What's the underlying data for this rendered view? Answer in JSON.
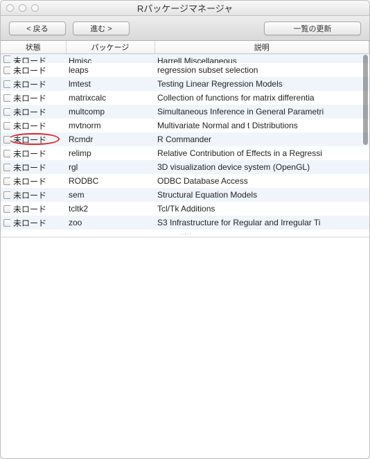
{
  "window": {
    "title": "Rパッケージマネージャ"
  },
  "toolbar": {
    "back": "< 戻る",
    "forward": "進む >",
    "refresh": "一覧の更新"
  },
  "columns": {
    "status": "状態",
    "package": "パッケージ",
    "description": "説明"
  },
  "status_label": "未ロード",
  "rows": [
    {
      "pkg": "Hmisc",
      "desc": "Harrell Miscellaneous",
      "cut": true
    },
    {
      "pkg": "leaps",
      "desc": "regression subset selection"
    },
    {
      "pkg": "lmtest",
      "desc": "Testing Linear Regression Models"
    },
    {
      "pkg": "matrixcalc",
      "desc": "Collection of functions for matrix differentia"
    },
    {
      "pkg": "multcomp",
      "desc": "Simultaneous Inference in General Parametri"
    },
    {
      "pkg": "mvtnorm",
      "desc": "Multivariate Normal and t Distributions"
    },
    {
      "pkg": "Rcmdr",
      "desc": "R Commander",
      "highlight": true
    },
    {
      "pkg": "relimp",
      "desc": "Relative Contribution of Effects in a Regressi"
    },
    {
      "pkg": "rgl",
      "desc": "3D visualization device system (OpenGL)"
    },
    {
      "pkg": "RODBC",
      "desc": "ODBC Database Access"
    },
    {
      "pkg": "sem",
      "desc": "Structural Equation Models"
    },
    {
      "pkg": "tcltk2",
      "desc": "Tcl/Tk Additions"
    },
    {
      "pkg": "zoo",
      "desc": "S3 Infrastructure for Regular and Irregular Ti"
    }
  ]
}
